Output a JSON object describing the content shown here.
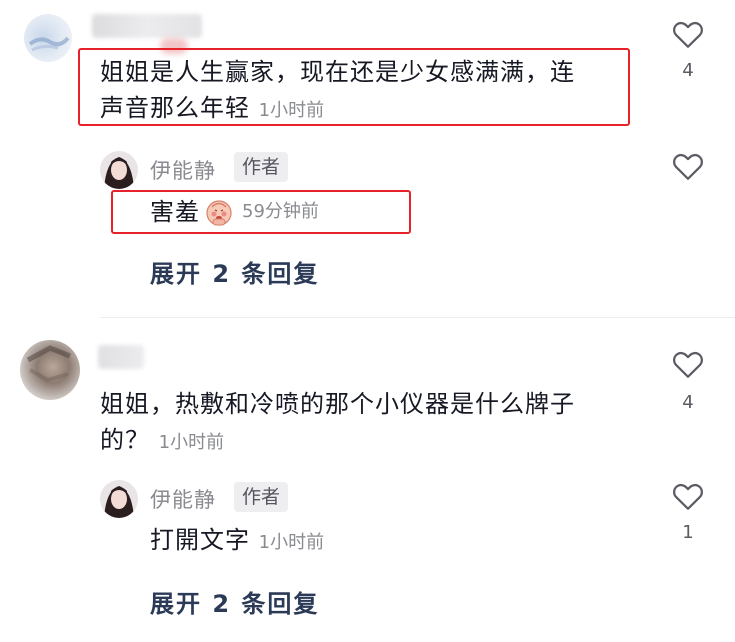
{
  "comments": [
    {
      "text_line1": "姐姐是人生赢家，现在还是少女感满满，连",
      "text_line2": "声音那么年轻",
      "time": "1小时前",
      "likes": "4",
      "reply": {
        "author": "伊能静",
        "badge": "作者",
        "text": "害羞",
        "emoji": "shy-face-emoji",
        "time": "59分钟前",
        "likes": ""
      },
      "expand_label": "展开 2 条回复"
    },
    {
      "text_line1": "姐姐，热敷和冷喷的那个小仪器是什么牌子",
      "text_line2": "的？",
      "time": "1小时前",
      "likes": "4",
      "reply": {
        "author": "伊能静",
        "badge": "作者",
        "text": "打開文字",
        "time": "1小时前",
        "likes": "1"
      },
      "expand_label": "展开 2 条回复"
    }
  ],
  "colors": {
    "highlight": "#e8222a",
    "expand_text": "#2b3a57",
    "muted": "#8a8b91"
  }
}
